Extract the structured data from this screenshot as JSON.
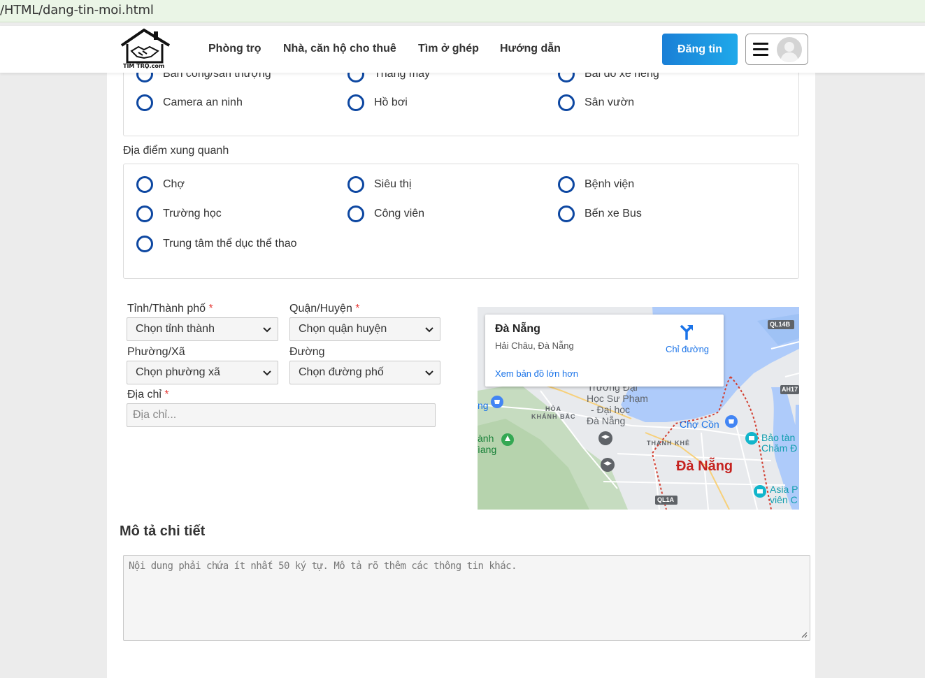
{
  "browser": {
    "url": "/HTML/dang-tin-moi.html"
  },
  "header": {
    "logo_text": "TÌM TRỌ.com",
    "nav": [
      "Phòng trọ",
      "Nhà, căn hộ cho thuê",
      "Tìm ở ghép",
      "Hướng dẫn"
    ],
    "post_button": "Đăng tin"
  },
  "amenities": {
    "partial_row": [
      "Ban công/sân thượng",
      "Thang máy",
      "Bãi đỗ xe riêng"
    ],
    "items": [
      "Camera an ninh",
      "Hồ bơi",
      "Sân vườn"
    ]
  },
  "nearby": {
    "title": "Địa điểm xung quanh",
    "items": [
      "Chợ",
      "Siêu thị",
      "Bệnh viện",
      "Trường học",
      "Công viên",
      "Bến xe Bus",
      "Trung tâm thể dục thể thao"
    ]
  },
  "address_form": {
    "province": {
      "label": "Tỉnh/Thành phố",
      "required": "*",
      "value": "Chọn tỉnh thành"
    },
    "district": {
      "label": "Quận/Huyện",
      "required": "*",
      "value": "Chọn quận huyện"
    },
    "ward": {
      "label": "Phường/Xã",
      "value": "Chọn phường xã"
    },
    "street": {
      "label": "Đường",
      "value": "Chọn đường phố"
    },
    "address": {
      "label": "Địa chỉ",
      "required": "*",
      "placeholder": "Địa chỉ..."
    }
  },
  "map": {
    "place": "Đà Nẵng",
    "address": "Hải Châu, Đà Nẵng",
    "directions": "Chỉ đường",
    "view_larger": "Xem bản đồ lớn hơn",
    "labels": {
      "city": "Đà Nẵng",
      "cho_con": "Chợ Cồn",
      "thanh_khe": "THANH KHÊ",
      "hoa": "HÒA",
      "khanh_bac": "KHÁNH BẮC",
      "university": [
        "Trường Đại",
        "Học Sư Phạm",
        "- Đại học",
        "Đà Nẵng"
      ],
      "museum": [
        "Bảo tàn",
        "Chăm Đ"
      ],
      "asia": [
        "Asia P",
        "viên C"
      ],
      "left_edge": [
        "ành",
        "ìang"
      ],
      "ng": "ng",
      "roads": [
        "QL14B",
        "AH17",
        "QL1A"
      ]
    }
  },
  "description": {
    "title": "Mô tả chi tiết",
    "placeholder": "Nội dung phải chứa ít nhất 50 ký tự. Mô tả rõ thêm các thông tin khác."
  },
  "colors": {
    "accent": "#0d47a1",
    "button": "#1a8fe0",
    "required": "#e53935",
    "link": "#1a73e8"
  }
}
